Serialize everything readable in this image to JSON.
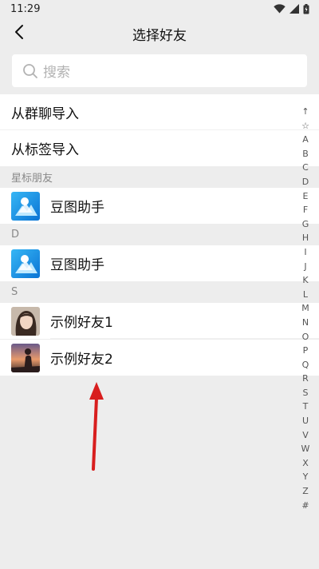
{
  "status_bar": {
    "time": "11:29",
    "icons": [
      "wifi-icon",
      "signal-icon",
      "battery-icon"
    ]
  },
  "nav": {
    "title": "选择好友",
    "back_icon": "chevron-left-icon"
  },
  "search": {
    "placeholder": "搜索",
    "icon": "search-icon"
  },
  "actions": [
    {
      "label": "从群聊导入"
    },
    {
      "label": "从标签导入"
    }
  ],
  "sections": [
    {
      "header": "星标朋友",
      "contacts": [
        {
          "name": "豆图助手",
          "avatar": "app-logo-blue"
        }
      ]
    },
    {
      "header": "D",
      "contacts": [
        {
          "name": "豆图助手",
          "avatar": "app-logo-blue"
        }
      ]
    },
    {
      "header": "S",
      "contacts": [
        {
          "name": "示例好友1",
          "avatar": "photo-portrait"
        },
        {
          "name": "示例好友2",
          "avatar": "photo-sunset"
        }
      ]
    }
  ],
  "index_bar": [
    "↑",
    "☆",
    "A",
    "B",
    "C",
    "D",
    "E",
    "F",
    "G",
    "H",
    "I",
    "J",
    "K",
    "L",
    "M",
    "N",
    "O",
    "P",
    "Q",
    "R",
    "S",
    "T",
    "U",
    "V",
    "W",
    "X",
    "Y",
    "Z",
    "#"
  ],
  "annotation": {
    "type": "red-arrow",
    "color": "#d81e1e"
  },
  "colors": {
    "background": "#ededed",
    "accent_blue": "#1aa0f0",
    "arrow_red": "#d81e1e"
  }
}
